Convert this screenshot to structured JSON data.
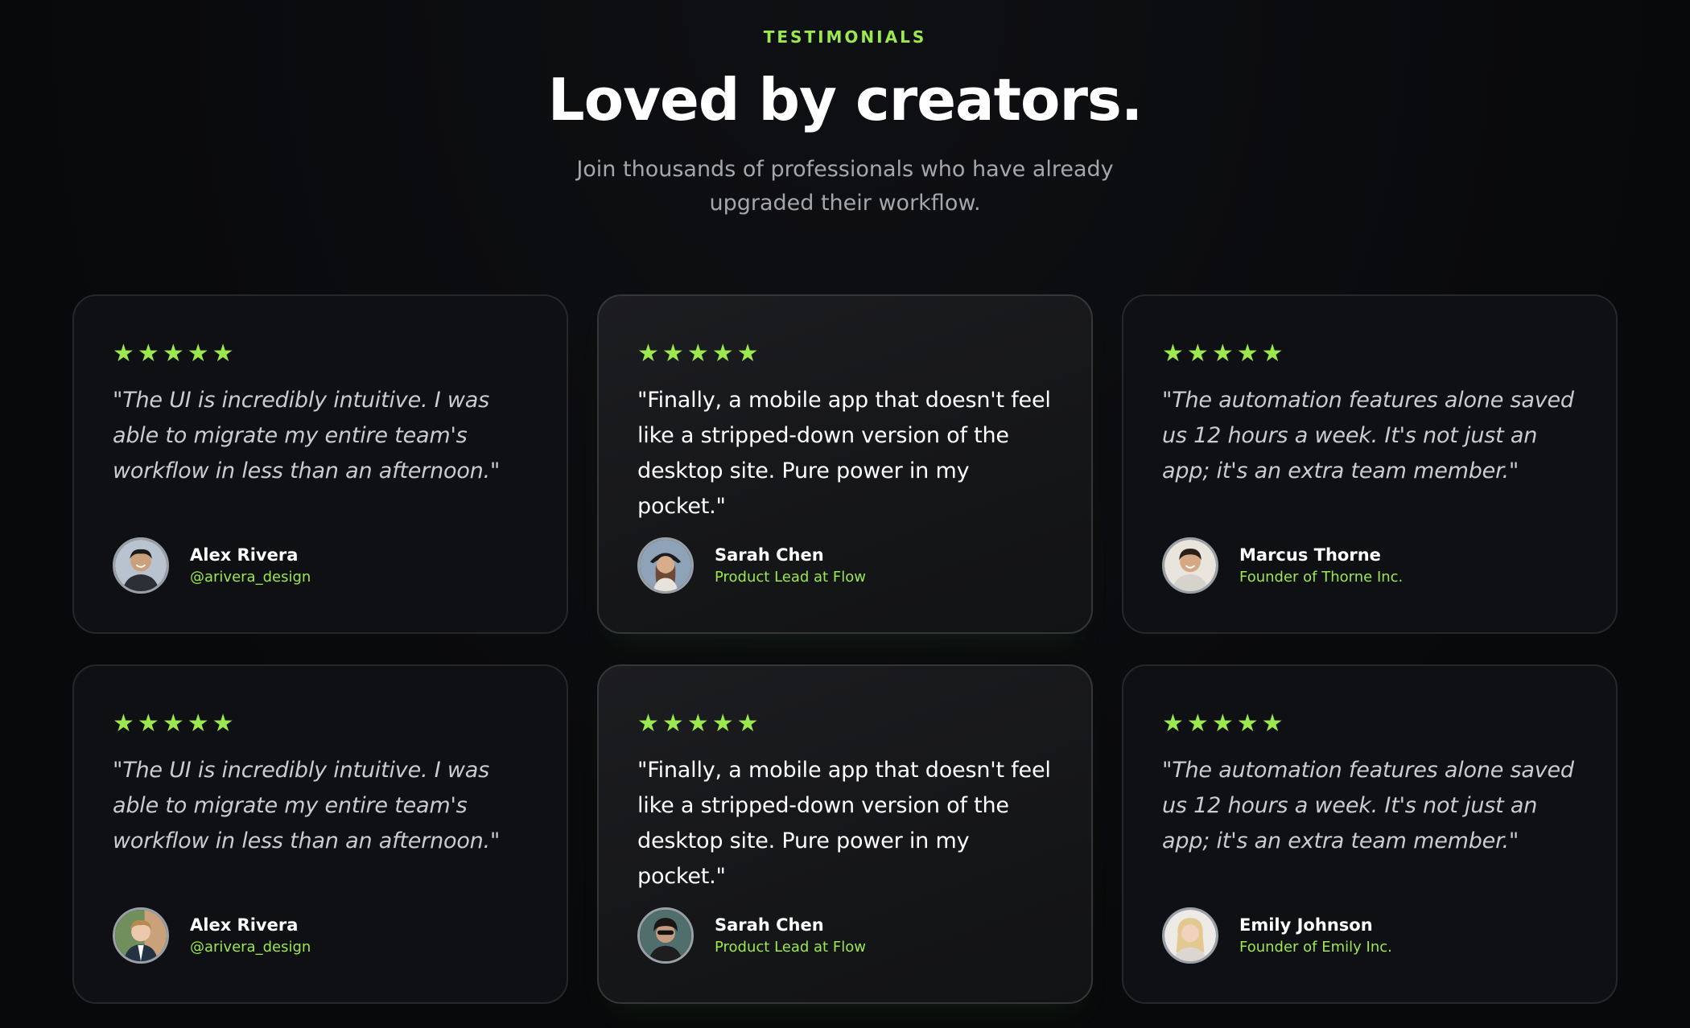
{
  "header": {
    "eyebrow": "TESTIMONIALS",
    "title": "Loved by creators.",
    "subtitle": "Join thousands of professionals who have already upgraded their workflow."
  },
  "colors": {
    "accent": "#9be84f",
    "background": "#090a0c",
    "card": "#0f1013"
  },
  "rating_icon": "star-icon",
  "testimonials": [
    {
      "rating": 5,
      "quote": "\"The UI is incredibly intuitive. I was able to migrate my entire team's workflow in less than an afternoon.\"",
      "name": "Alex Rivera",
      "role": "@arivera_design",
      "avatar_icon": "avatar-icon"
    },
    {
      "rating": 5,
      "quote": "\"Finally, a mobile app that doesn't feel like a stripped-down version of the desktop site. Pure power in my pocket.\"",
      "name": "Sarah Chen",
      "role": "Product Lead at Flow",
      "avatar_icon": "avatar-icon"
    },
    {
      "rating": 5,
      "quote": "\"The automation features alone saved us 12 hours a week. It's not just an app; it's an extra team member.\"",
      "name": "Marcus Thorne",
      "role": "Founder of Thorne Inc.",
      "avatar_icon": "avatar-icon"
    },
    {
      "rating": 5,
      "quote": "\"The UI is incredibly intuitive. I was able to migrate my entire team's workflow in less than an afternoon.\"",
      "name": "Alex Rivera",
      "role": "@arivera_design",
      "avatar_icon": "avatar-icon"
    },
    {
      "rating": 5,
      "quote": "\"Finally, a mobile app that doesn't feel like a stripped-down version of the desktop site. Pure power in my pocket.\"",
      "name": "Sarah Chen",
      "role": "Product Lead at Flow",
      "avatar_icon": "avatar-icon"
    },
    {
      "rating": 5,
      "quote": "\"The automation features alone saved us 12 hours a week. It's not just an app; it's an extra team member.\"",
      "name": "Emily Johnson",
      "role": "Founder of Emily Inc.",
      "avatar_icon": "avatar-icon"
    }
  ]
}
